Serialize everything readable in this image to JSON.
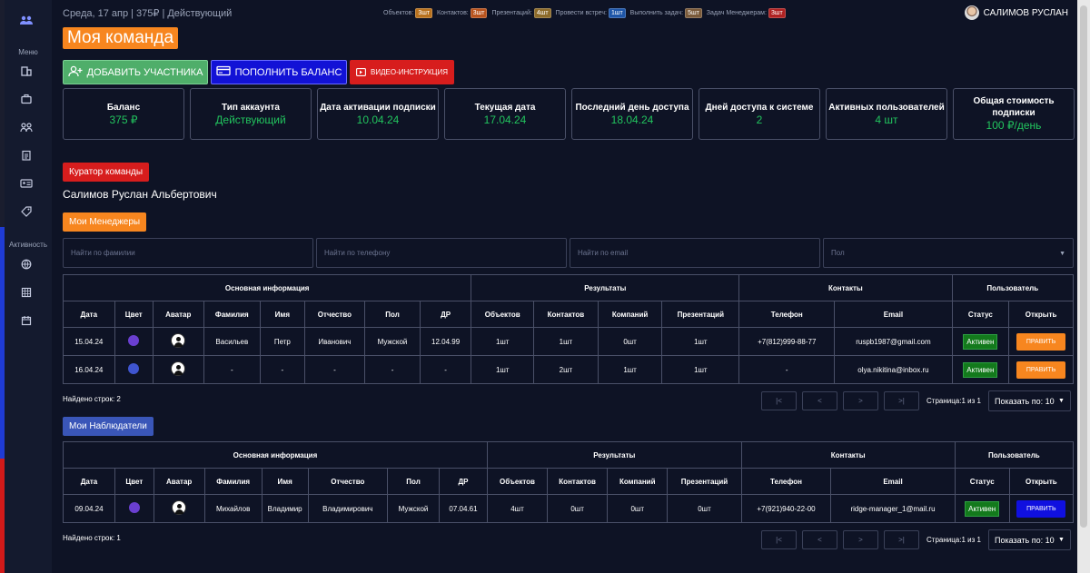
{
  "header": {
    "date_line": "Среда, 17 апр | 375₽ | Действующий",
    "user_name": "САЛИМОВ РУСЛАН",
    "stats": [
      {
        "label": "Объектов:",
        "badge": "3шт",
        "color": "#b8711d"
      },
      {
        "label": "Контактов:",
        "badge": "3шт",
        "color": "#b8531d"
      },
      {
        "label": "Презентаций:",
        "badge": "4шт",
        "color": "#8d6b2a"
      },
      {
        "label": "Провести встреч:",
        "badge": "1шт",
        "color": "#1e56a8"
      },
      {
        "label": "Выполнить задач:",
        "badge": "5шт",
        "color": "#7a5a3a"
      },
      {
        "label": "Задач Менеджерам:",
        "badge": "3шт",
        "color": "#b02222"
      }
    ]
  },
  "sidebar": {
    "menu_label": "Меню",
    "activity_label": "Активность"
  },
  "page_title": "Моя команда",
  "actions": {
    "add_member": "ДОБАВИТЬ УЧАСТНИКА",
    "top_up": "ПОПОЛНИТЬ БАЛАНС",
    "video": "ВИДЕО-ИНСТРУКЦИЯ"
  },
  "cards": [
    {
      "title": "Баланс",
      "value": "375 ₽"
    },
    {
      "title": "Тип аккаунта",
      "value": "Действующий"
    },
    {
      "title": "Дата активации подписки",
      "value": "10.04.24"
    },
    {
      "title": "Текущая дата",
      "value": "17.04.24"
    },
    {
      "title": "Последний день доступа",
      "value": "18.04.24"
    },
    {
      "title": "Дней доступа к системе",
      "value": "2"
    },
    {
      "title": "Активных пользователей",
      "value": "4 шт"
    },
    {
      "title": "Общая стоимость подписки",
      "value": "100 ₽/день"
    }
  ],
  "curator": {
    "label": "Куратор команды",
    "name": "Салимов Руслан Альбертович"
  },
  "managers_label": "Мои Менеджеры",
  "observers_label": "Мои Наблюдатели",
  "filters": {
    "surname": "Найти по фамилии",
    "phone": "Найти по телефону",
    "email": "Найти по email",
    "gender": "Пол"
  },
  "table_groups": {
    "main": "Основная информация",
    "results": "Результаты",
    "contacts": "Контакты",
    "user": "Пользователь"
  },
  "columns": [
    "Дата",
    "Цвет",
    "Аватар",
    "Фамилия",
    "Имя",
    "Отчество",
    "Пол",
    "ДР",
    "Объектов",
    "Контактов",
    "Компаний",
    "Презентаций",
    "Телефон",
    "Email",
    "Статус",
    "Открыть"
  ],
  "managers": [
    {
      "date": "15.04.24",
      "color": "#6a3fd0",
      "surname": "Васильев",
      "name": "Петр",
      "patronymic": "Иванович",
      "gender": "Мужской",
      "birthday": "12.04.99",
      "objects": "1шт",
      "contacts": "1шт",
      "companies": "0шт",
      "presentations": "1шт",
      "phone": "+7(812)999-88-77",
      "email": "ruspb1987@gmail.com",
      "status": "Активен",
      "action": "ПРАВИТЬ",
      "action_color": "#f7861f"
    },
    {
      "date": "16.04.24",
      "color": "#3f55d0",
      "surname": "-",
      "name": "-",
      "patronymic": "-",
      "gender": "-",
      "birthday": "-",
      "objects": "1шт",
      "contacts": "2шт",
      "companies": "1шт",
      "presentations": "1шт",
      "phone": "-",
      "email": "olya.nikitina@inbox.ru",
      "status": "Активен",
      "action": "ПРАВИТЬ",
      "action_color": "#f7861f"
    }
  ],
  "observers": [
    {
      "date": "09.04.24",
      "color": "#6a3fd0",
      "surname": "Михайлов",
      "name": "Владимир",
      "patronymic": "Владимирович",
      "gender": "Мужской",
      "birthday": "07.04.61",
      "objects": "4шт",
      "contacts": "0шт",
      "companies": "0шт",
      "presentations": "0шт",
      "phone": "+7(921)940-22-00",
      "email": "ridge-manager_1@mail.ru",
      "status": "Активен",
      "action": "ПРАВИТЬ",
      "action_color": "#1010e0"
    }
  ],
  "managers_found": "Найдено строк:  2",
  "observers_found": "Найдено строк:  1",
  "pagination": {
    "page_info": "Страница:1 из 1",
    "page_size": "Показать по: 10"
  }
}
